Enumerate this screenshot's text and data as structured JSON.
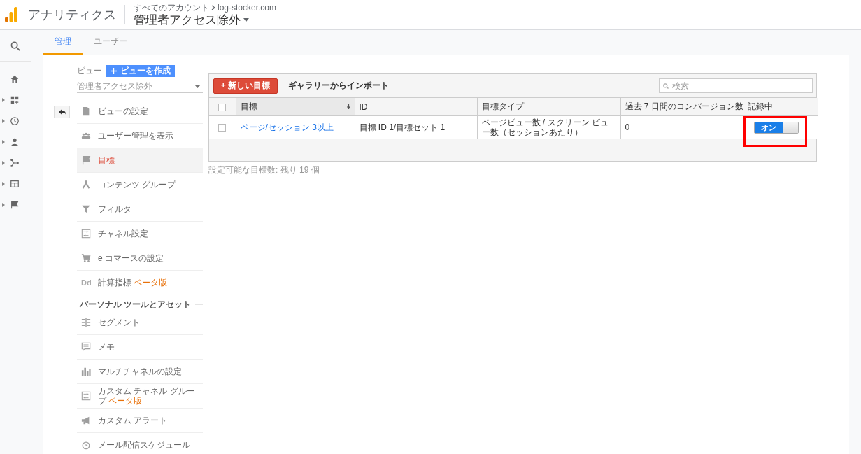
{
  "header": {
    "product": "アナリティクス",
    "breadcrumb": [
      "すべてのアカウント",
      "log-stocker.com"
    ],
    "view_title": "管理者アクセス除外"
  },
  "tabs": [
    {
      "label": "管理",
      "selected": true
    },
    {
      "label": "ユーザー",
      "selected": false
    }
  ],
  "view_panel": {
    "label": "ビュー",
    "create_button": "ビューを作成",
    "view_select": "管理者アクセス除外"
  },
  "menu": [
    {
      "label": "ビューの設定",
      "selected": false
    },
    {
      "label": "ユーザー管理を表示",
      "selected": false
    },
    {
      "label": "目標",
      "selected": true
    },
    {
      "label": "コンテンツ グループ",
      "selected": false
    },
    {
      "label": "フィルタ",
      "selected": false
    },
    {
      "label": "チャネル設定",
      "selected": false
    },
    {
      "label": "e コマースの設定",
      "selected": false
    },
    {
      "label": "計算指標",
      "badge": "ベータ版",
      "icon_text": "Dd",
      "selected": false
    }
  ],
  "personal_section": {
    "title": "パーソナル ツールとアセット",
    "items": [
      {
        "label": "セグメント",
        "selected": false
      },
      {
        "label": "メモ",
        "selected": false
      },
      {
        "label": "マルチチャネルの設定",
        "selected": false
      },
      {
        "label": "カスタム チャネル グループ",
        "badge": "ベータ版",
        "selected": false
      },
      {
        "label": "カスタム アラート",
        "selected": false
      },
      {
        "label": "メール配信スケジュール",
        "selected": false
      }
    ]
  },
  "goals": {
    "new_button": "+ 新しい目標",
    "import_link": "ギャラリーからインポート",
    "search": {
      "placeholder": "検索"
    },
    "header_checked": false,
    "columns": [
      {
        "label": "目標",
        "sorted": true
      },
      {
        "label": "ID",
        "sorted": false
      },
      {
        "label": "目標タイプ",
        "sorted": false
      },
      {
        "label": "過去 7 日間のコンバージョン数",
        "sorted": false
      },
      {
        "label": "記録中",
        "sorted": false
      }
    ],
    "rows": [
      {
        "checked": false,
        "name": "ページ/セッション 3以上",
        "id": "目標 ID 1/目標セット 1",
        "type": "ページビュー数 / スクリーン ビュー数（セッションあたり）",
        "conversions": "0",
        "recording": {
          "on": true,
          "label": "オン"
        },
        "highlighted": true
      }
    ],
    "remaining": "設定可能な目標数: 残り 19 個"
  }
}
